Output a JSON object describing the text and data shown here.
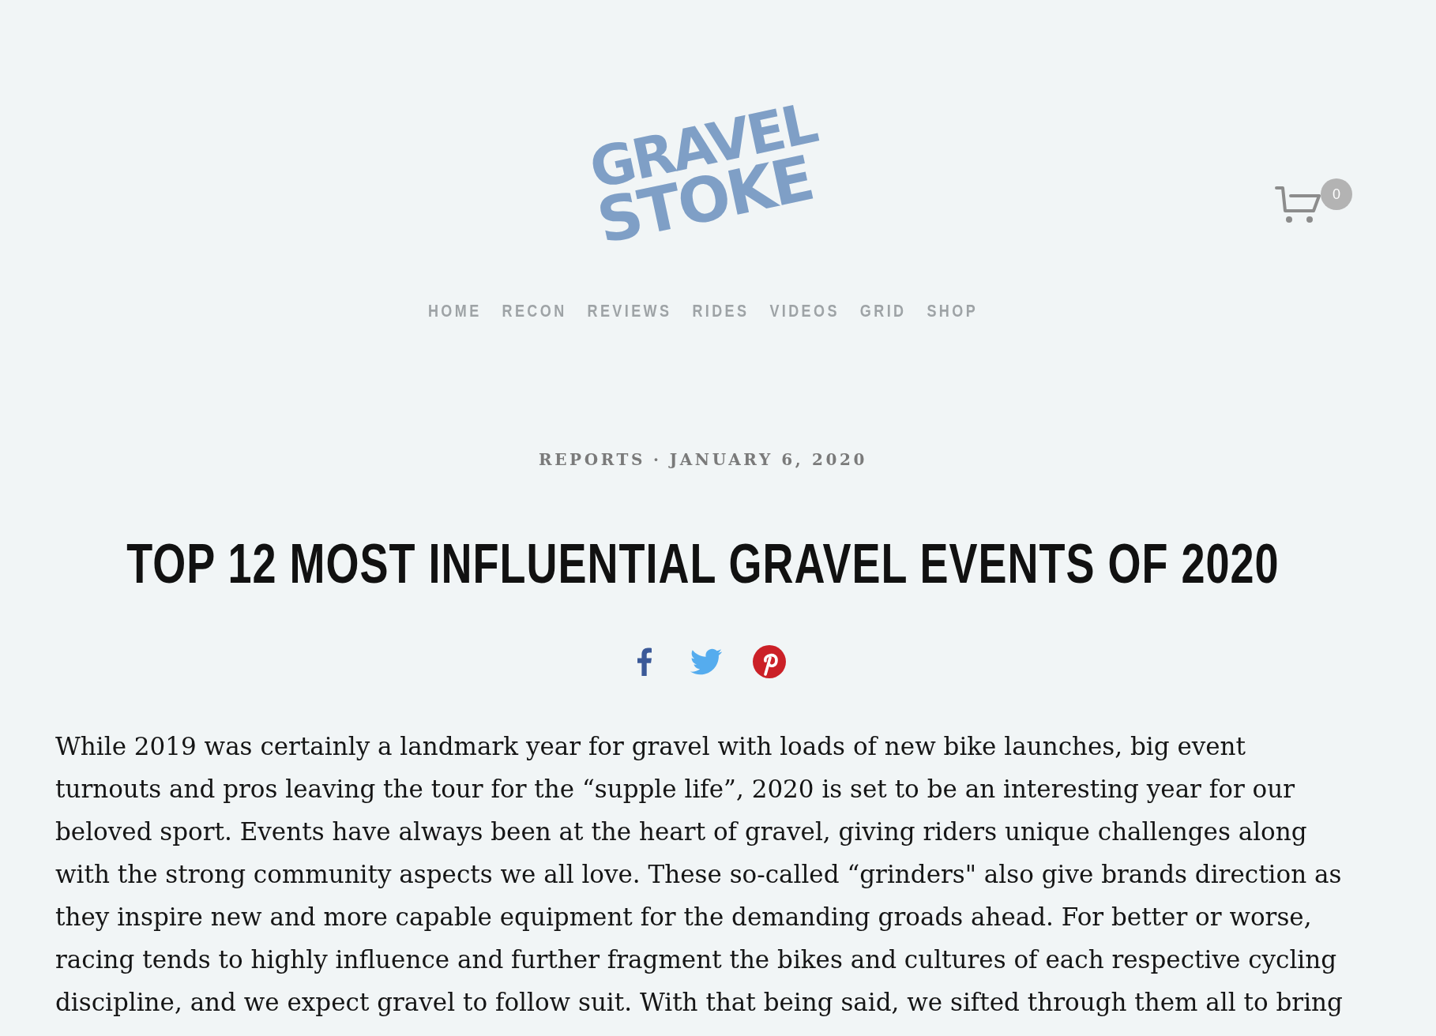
{
  "header": {
    "logo": {
      "lines": [
        "GRAVEL",
        "STOKE"
      ]
    },
    "cart": {
      "count": "0"
    }
  },
  "nav": [
    {
      "label": "HOME"
    },
    {
      "label": "RECON"
    },
    {
      "label": "REVIEWS"
    },
    {
      "label": "RIDES"
    },
    {
      "label": "VIDEOS"
    },
    {
      "label": "GRID"
    },
    {
      "label": "SHOP"
    }
  ],
  "article": {
    "category": "REPORTS",
    "separator": "·",
    "date": "JANUARY 6, 2020",
    "title": "TOP 12 MOST INFLUENTIAL GRAVEL EVENTS OF 2020",
    "share": [
      {
        "kind": "facebook"
      },
      {
        "kind": "twitter"
      },
      {
        "kind": "pinterest"
      }
    ],
    "body": "While 2019 was certainly a landmark year for gravel with loads of new bike launches, big event turnouts and pros leaving the tour for the “supple life”, 2020 is set to be an interesting year for our beloved sport. Events have always been at the heart of gravel, giving riders unique challenges along with the strong community aspects we all love. These so-called “grinders\" also give brands direction as they inspire new and more capable equipment for the demanding groads ahead. For better or worse, racing tends to highly influence and further fragment the bikes and cultures of each respective cycling discipline, and we expect gravel to follow suit. With that being said, we sifted through them all to bring"
  }
}
